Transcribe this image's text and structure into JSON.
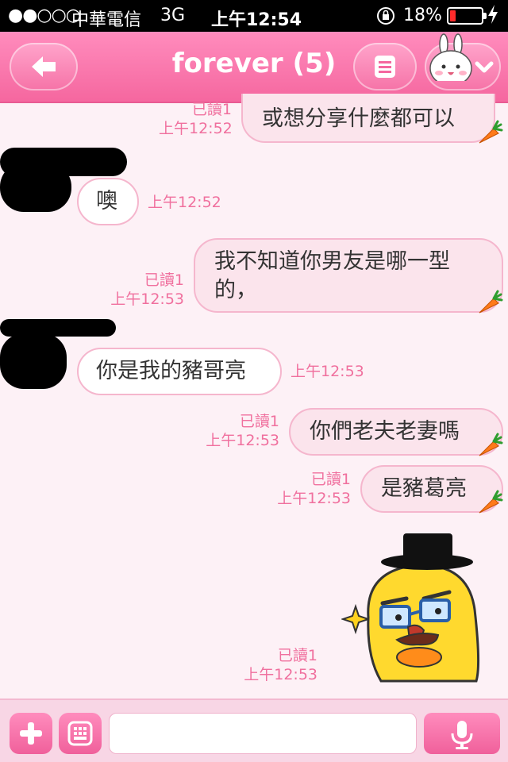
{
  "status_bar": {
    "signal": "●●○○○",
    "carrier": "中華電信",
    "network": "3G",
    "time": "上午12:54",
    "battery_percent": "18%",
    "battery_level": 0.18
  },
  "header": {
    "title": "forever (5)",
    "back_icon": "arrow-left-icon",
    "menu_icon": "list-icon",
    "avatar_icon": "bunny-icon",
    "accent": "#f5679f"
  },
  "messages": [
    {
      "direction": "out",
      "read": "已讀1",
      "time": "上午12:52",
      "text": "或想分享什麼都可以"
    },
    {
      "direction": "in",
      "time": "上午12:52",
      "text": "噢"
    },
    {
      "direction": "out",
      "read": "已讀1",
      "time": "上午12:53",
      "text": "我不知道你男友是哪一型的，"
    },
    {
      "direction": "in",
      "time": "上午12:53",
      "text": "你是我的豬哥亮"
    },
    {
      "direction": "out",
      "read": "已讀1",
      "time": "上午12:53",
      "text": "你們老夫老妻嗎"
    },
    {
      "direction": "out",
      "read": "已讀1",
      "time": "上午12:53",
      "text": "是豬葛亮"
    },
    {
      "direction": "out",
      "read": "已讀1",
      "time": "上午12:53",
      "sticker": "duck-with-top-hat-sticker"
    }
  ],
  "input_bar": {
    "plus_icon": "plus-icon",
    "keyboard_icon": "keyboard-icon",
    "mic_icon": "microphone-icon",
    "text_value": ""
  }
}
